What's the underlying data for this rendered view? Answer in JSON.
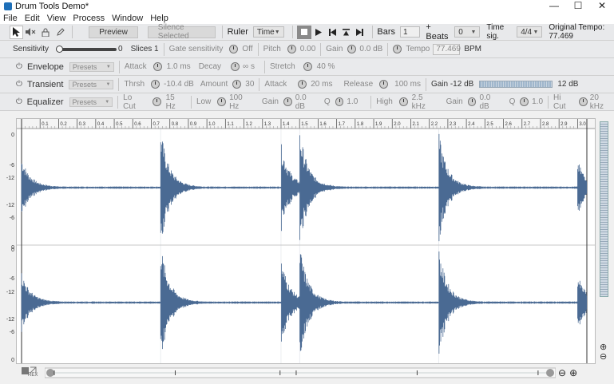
{
  "window": {
    "title": "Drum Tools Demo*",
    "controls": [
      "—",
      "☐",
      "✕"
    ]
  },
  "menu": [
    "File",
    "Edit",
    "View",
    "Process",
    "Window",
    "Help"
  ],
  "toolbar": {
    "preview_label": "Preview",
    "silence_label": "Silence Selected",
    "ruler_label": "Ruler",
    "ruler_mode": "Time",
    "bars_label": "Bars",
    "bars_value": "1",
    "beats_label": "+ Beats",
    "beats_value": "0",
    "timesig_label": "Time sig.",
    "timesig_value": "4/4",
    "original_tempo": "Original Tempo: 77.469"
  },
  "row1": {
    "sensitivity_label": "Sensitivity",
    "sensitivity_value": "0",
    "sensitivity_level": 0,
    "slices_label": "Slices 1",
    "gate_label": "Gate sensitivity",
    "gate_value": "Off",
    "pitch_label": "Pitch",
    "pitch_value": "0.00",
    "gain_label": "Gain",
    "gain_value": "0.0 dB",
    "tempo_label": "Tempo",
    "tempo_value": "77.469",
    "bpm_label": "BPM"
  },
  "row2": {
    "name": "Envelope",
    "presets": "Presets",
    "attack_label": "Attack",
    "attack_value": "1.0 ms",
    "decay_label": "Decay",
    "decay_value": "∞ s",
    "stretch_label": "Stretch",
    "stretch_value": "40 %"
  },
  "row3": {
    "name": "Transient",
    "presets": "Presets",
    "thrsh_label": "Thrsh",
    "thrsh_value": "-10.4 dB",
    "amount_label": "Amount",
    "amount_value": "30",
    "attack_label": "Attack",
    "attack_value": "20 ms",
    "release_label": "Release",
    "release_value": "100 ms",
    "gain_label": "Gain -12 dB",
    "gain_max": "12 dB"
  },
  "row4": {
    "name": "Equalizer",
    "presets": "Presets",
    "locut_label": "Lo Cut",
    "locut_value": "15 Hz",
    "low_label": "Low",
    "low_value": "100 Hz",
    "gain1_label": "Gain",
    "gain1_value": "0.0 dB",
    "q1_label": "Q",
    "q1_value": "1.0",
    "high_label": "High",
    "high_value": "2.5 kHz",
    "gain2_label": "Gain",
    "gain2_value": "0.0 dB",
    "q2_label": "Q",
    "q2_value": "1.0",
    "hicut_label": "Hi Cut",
    "hicut_value": "20 kHz"
  },
  "ruler": {
    "ticks": [
      "0.1",
      "0.2",
      "0.3",
      "0.4",
      "0.5",
      "0.6",
      "0.7",
      "0.8",
      "0.9",
      "1.0",
      "1.1",
      "1.2",
      "1.3",
      "1.4",
      "1.5",
      "1.6",
      "1.7",
      "1.8",
      "1.9",
      "2.0",
      "2.1",
      "2.2",
      "2.3",
      "2.4",
      "2.5",
      "2.6",
      "2.7",
      "2.8",
      "2.9",
      "3.0"
    ]
  },
  "db_axis": [
    "0",
    "-6",
    "-12",
    "-12",
    "-6",
    "0",
    "0",
    "-6",
    "-12",
    "-12",
    "-6",
    "0"
  ],
  "waveform": {
    "color": "#4a6a93",
    "hits_seconds": [
      0.0,
      0.75,
      1.4,
      1.5,
      2.25,
      3.0
    ]
  },
  "bottom": {
    "rex_label": "REX"
  },
  "colors": {
    "accent": "#1e6fb8",
    "wave": "#4a6a93",
    "panel": "#e9eaec"
  }
}
